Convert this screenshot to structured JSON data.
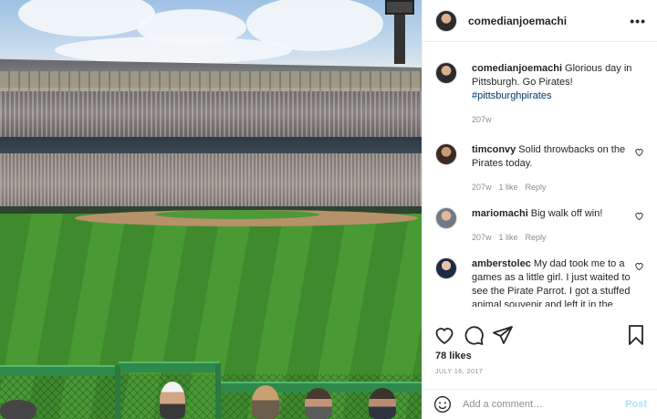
{
  "post": {
    "author": "comedianjoemachi",
    "caption_user": "comedianjoemachi",
    "caption_text": "Glorious day in Pittsburgh. Go Pirates!",
    "caption_tag": "#pittsburghpirates",
    "caption_age": "207w",
    "likes": "78 likes",
    "date": "JULY 16, 2017"
  },
  "comments": [
    {
      "user": "timconvy",
      "text": "Solid throwbacks on the Pirates today.",
      "age": "207w",
      "likes": "1 like",
      "reply": "Reply"
    },
    {
      "user": "mariomachi",
      "text": "Big walk off win!",
      "age": "207w",
      "likes": "1 like",
      "reply": "Reply"
    },
    {
      "user": "amberstolec",
      "text": "My dad took me to a games as a little girl. I just waited to see the Pirate Parrot. I got a stuffed animal souvenir and left it in the yard. My dog ate him.",
      "age": "",
      "likes": "",
      "reply": ""
    }
  ],
  "add_comment": {
    "placeholder": "Add a comment…",
    "post_label": "Post"
  },
  "icons": {
    "like": "heart-icon",
    "comment": "comment-icon",
    "share": "share-icon",
    "save": "bookmark-icon",
    "more": "more-options-icon",
    "emoji": "emoji-icon"
  }
}
